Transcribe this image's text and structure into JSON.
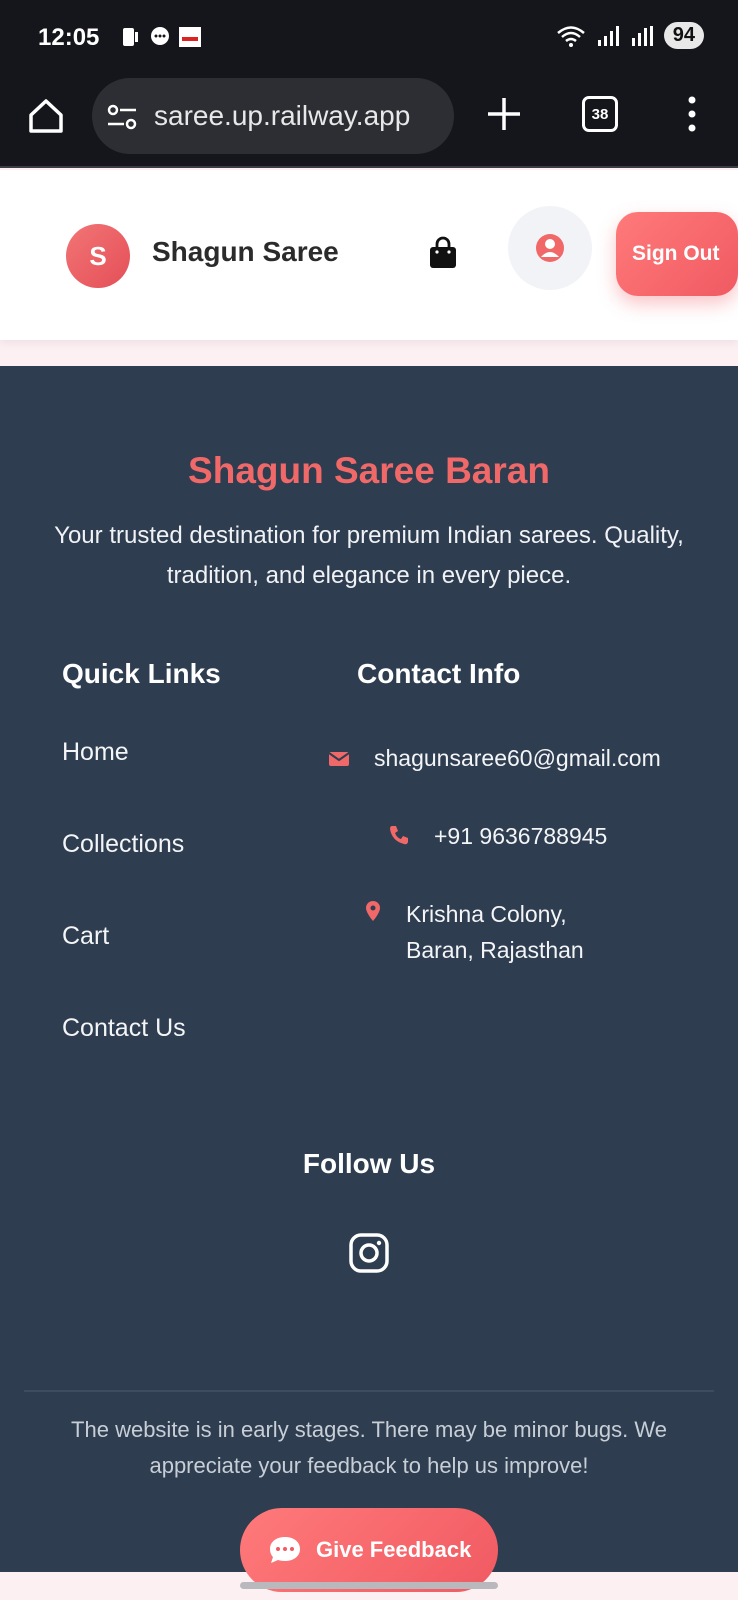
{
  "status_bar": {
    "time": "12:05",
    "battery": "94"
  },
  "browser": {
    "url": "saree.up.railway.app",
    "tab_count": "38"
  },
  "header": {
    "logo_letter": "S",
    "brand": "Shagun Saree",
    "signout_label": "Sign Out"
  },
  "footer": {
    "title": "Shagun Saree Baran",
    "description": "Your trusted destination for premium Indian sarees. Quality, tradition, and elegance in every piece.",
    "quick_links_heading": "Quick Links",
    "quick_links": [
      "Home",
      "Collections",
      "Cart",
      "Contact Us"
    ],
    "contact_heading": "Contact Info",
    "contact": {
      "email": "shagunsaree60@gmail.com",
      "phone": "+91 9636788945",
      "address_line1": "Krishna Colony,",
      "address_line2": "Baran, Rajasthan"
    },
    "follow_heading": "Follow Us",
    "note": "The website is in early stages. There may be minor bugs. We appreciate your feedback to help us improve!"
  },
  "feedback_button": "Give Feedback",
  "colors": {
    "accent": "#f06868",
    "footer_bg": "#2e3d50"
  }
}
